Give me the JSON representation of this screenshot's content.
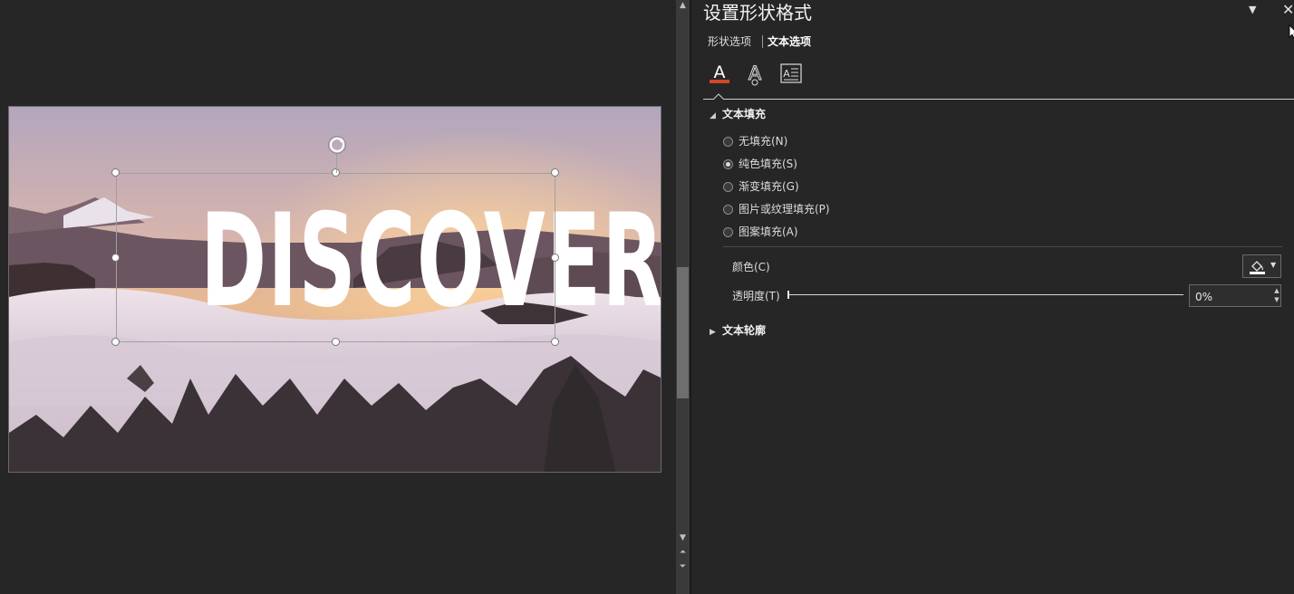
{
  "slide": {
    "title_text": "DISCOVER"
  },
  "pane": {
    "title": "设置形状格式",
    "tabs": {
      "shape": "形状选项",
      "text": "文本选项"
    },
    "icons": [
      "text-fill-outline-icon",
      "text-effects-icon",
      "textbox-layout-icon"
    ],
    "text_fill": {
      "heading": "文本填充",
      "options": [
        {
          "label": "无填充(N)",
          "selected": false
        },
        {
          "label": "纯色填充(S)",
          "selected": true
        },
        {
          "label": "渐变填充(G)",
          "selected": false
        },
        {
          "label": "图片或纹理填充(P)",
          "selected": false
        },
        {
          "label": "图案填充(A)",
          "selected": false
        }
      ],
      "color_label": "颜色(C)",
      "transparency_label": "透明度(T)",
      "transparency_value": "0%",
      "transparency_fraction": 0
    },
    "text_outline": {
      "heading": "文本轮廓"
    }
  },
  "colors": {
    "accent_red": "#d24726",
    "background": "#262626",
    "fill_swatch": "#ffffff"
  }
}
